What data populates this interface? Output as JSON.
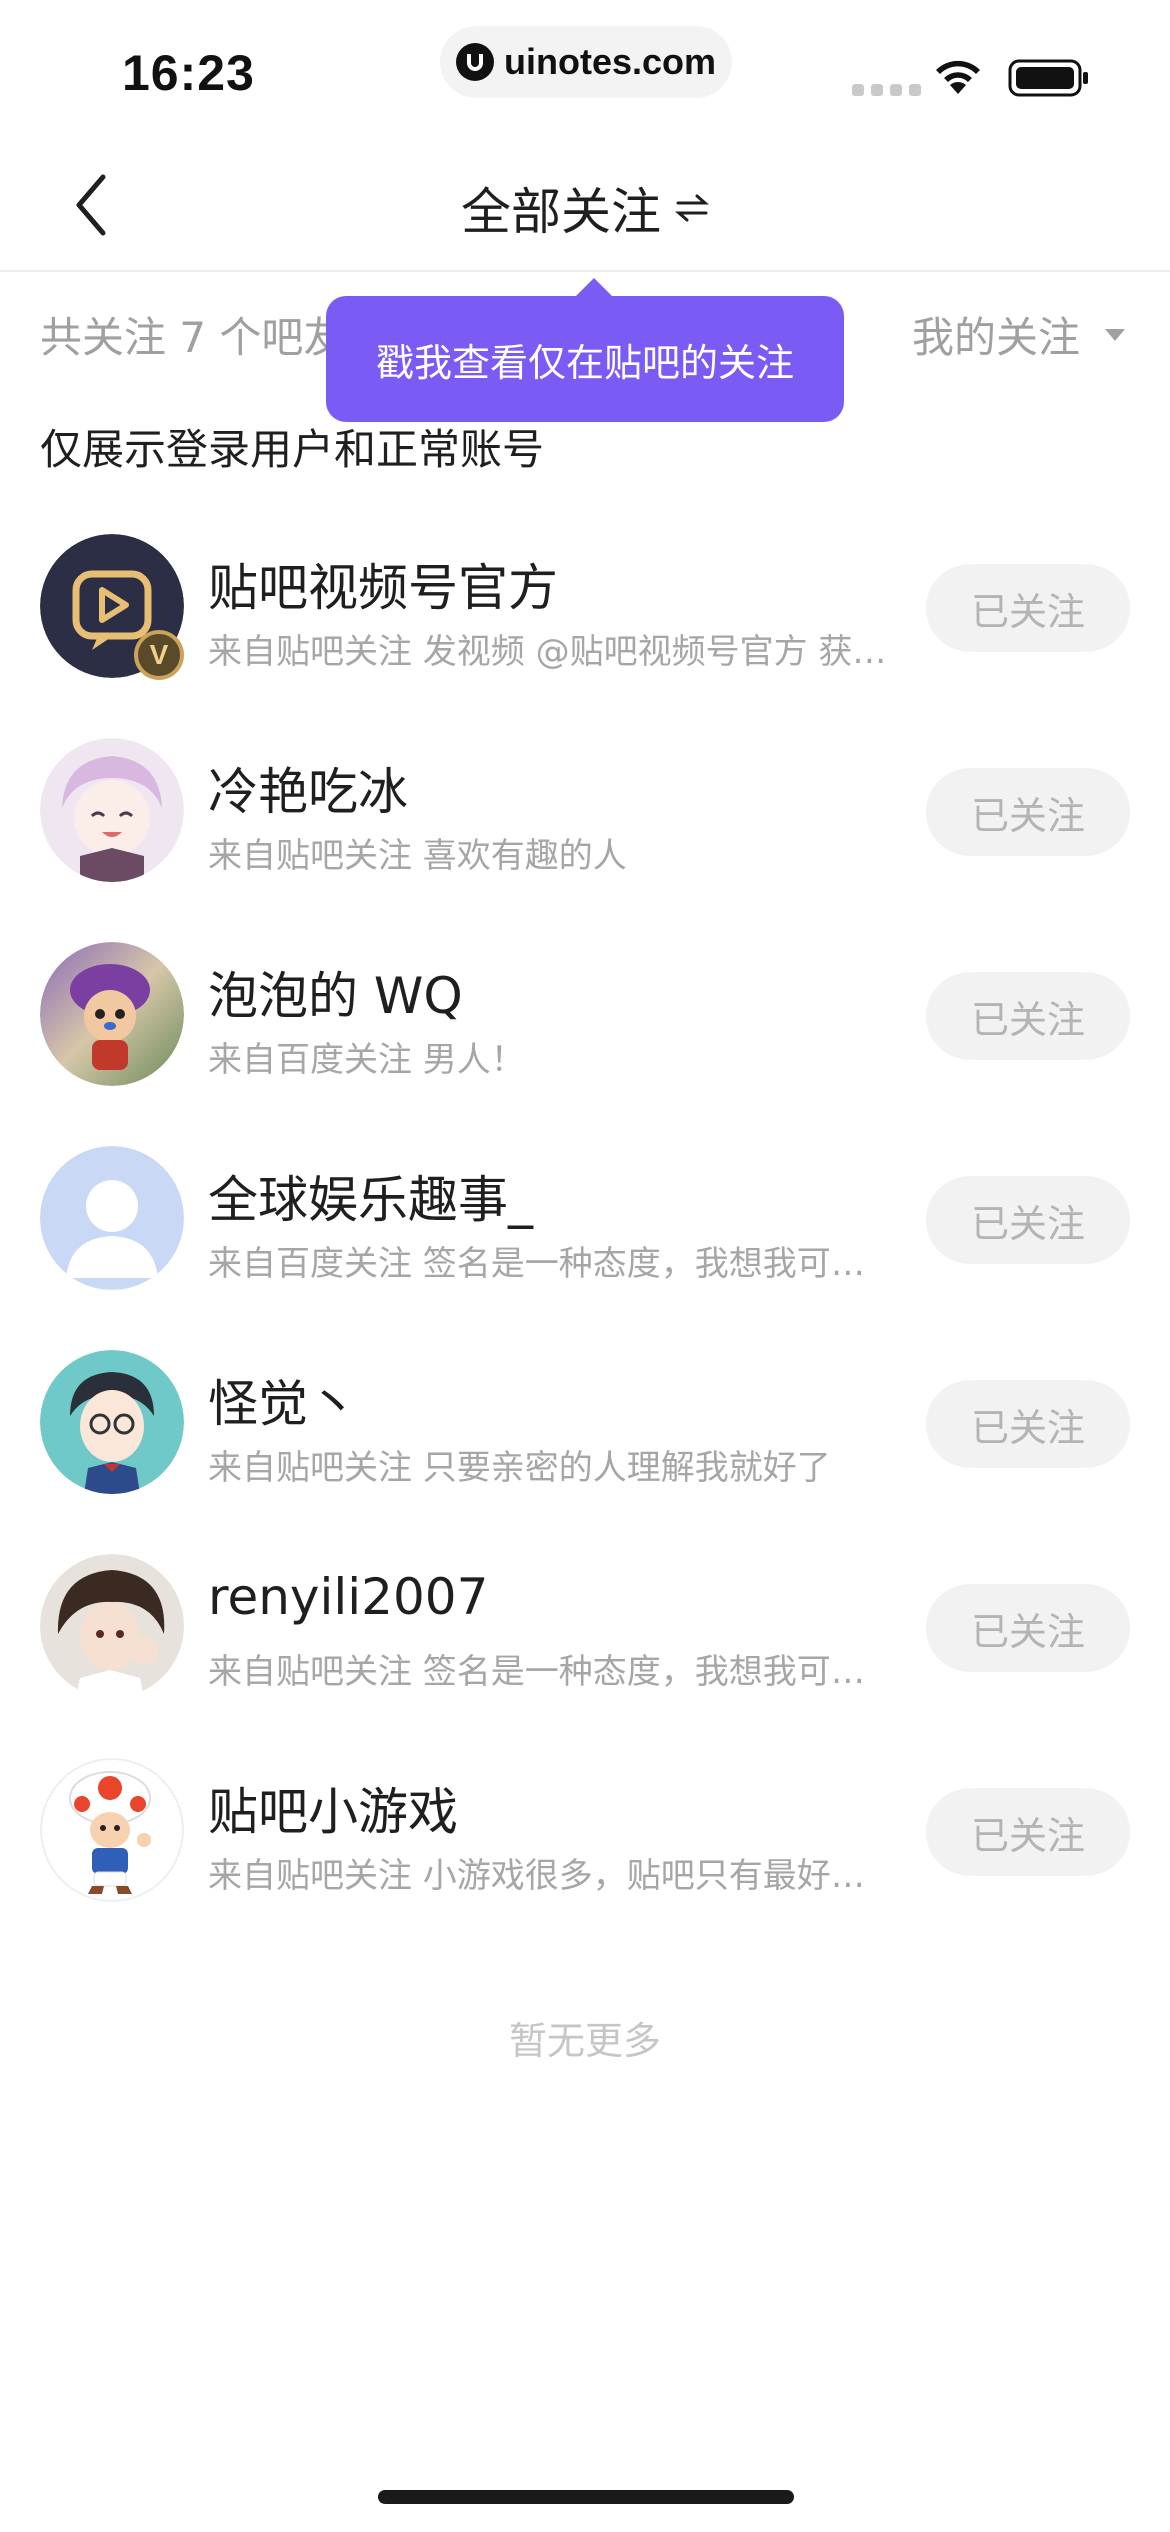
{
  "status_bar": {
    "time": "16:23",
    "url": "uinotes.com"
  },
  "nav": {
    "title": "全部关注",
    "back_icon": "chevron-left-icon",
    "switch_icon": "swap-icon"
  },
  "filter": {
    "count_text": "共关注 7 个吧友",
    "dropdown_label": "我的关注",
    "dropdown_icon": "caret-down-icon"
  },
  "tooltip": {
    "text": "戳我查看仅在贴吧的关注",
    "color": "#7a5cf5"
  },
  "notice": "仅展示登录用户和正常账号",
  "follows": [
    {
      "name": "贴吧视频号官方",
      "subtitle": "来自贴吧关注 发视频 @贴吧视频号官方 获得流量扶持",
      "button": "已关注",
      "avatar": "video-play-avatar",
      "verified": true
    },
    {
      "name": "冷艳吃冰",
      "subtitle": "来自贴吧关注 喜欢有趣的人",
      "button": "已关注",
      "avatar": "anime-girl-avatar",
      "verified": false
    },
    {
      "name": "泡泡的 WQ",
      "subtitle": "来自百度关注 男人！",
      "button": "已关注",
      "avatar": "chopper-avatar",
      "verified": false
    },
    {
      "name": "全球娱乐趣事_",
      "subtitle": "来自百度关注 签名是一种态度，我想我可以更酷",
      "button": "已关注",
      "avatar": "default-person-avatar",
      "verified": false
    },
    {
      "name": "怪觉丶",
      "subtitle": "来自贴吧关注 只要亲密的人理解我就好了",
      "button": "已关注",
      "avatar": "anime-boy-glasses-avatar",
      "verified": false
    },
    {
      "name": "renyili2007",
      "subtitle": "来自贴吧关注 签名是一种态度，我想我可以更酷",
      "button": "已关注",
      "avatar": "anime-boy-avatar",
      "verified": false
    },
    {
      "name": "贴吧小游戏",
      "subtitle": "来自贴吧关注 小游戏很多，贴吧只有最好玩的",
      "button": "已关注",
      "avatar": "mushroom-toad-avatar",
      "verified": false
    }
  ],
  "verified_badge": "V",
  "end_text": "暂无更多"
}
